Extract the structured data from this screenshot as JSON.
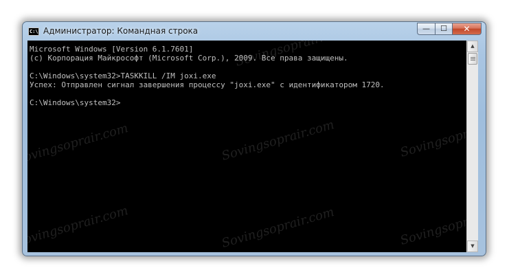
{
  "window": {
    "title": "Администратор: Командная строка",
    "icon_name": "console-app-icon",
    "controls": {
      "minimize": "—",
      "maximize": "☐",
      "close": "✕"
    }
  },
  "console": {
    "lines": [
      "Microsoft Windows [Version 6.1.7601]",
      "(c) Корпорация Майкрософт (Microsoft Corp.), 2009. Все права защищены.",
      "",
      "C:\\Windows\\system32>TASKKILL /IM joxi.exe",
      "Успех: Отправлен сигнал завершения процессу \"joxi.exe\" с идентификатором 1720.",
      "",
      "C:\\Windows\\system32>"
    ],
    "text_color": "#c0c0c0",
    "background": "#000000"
  },
  "scrollbar": {
    "up": "▲",
    "down": "▼"
  },
  "watermark": {
    "text": "Sovingsoprair.com"
  }
}
